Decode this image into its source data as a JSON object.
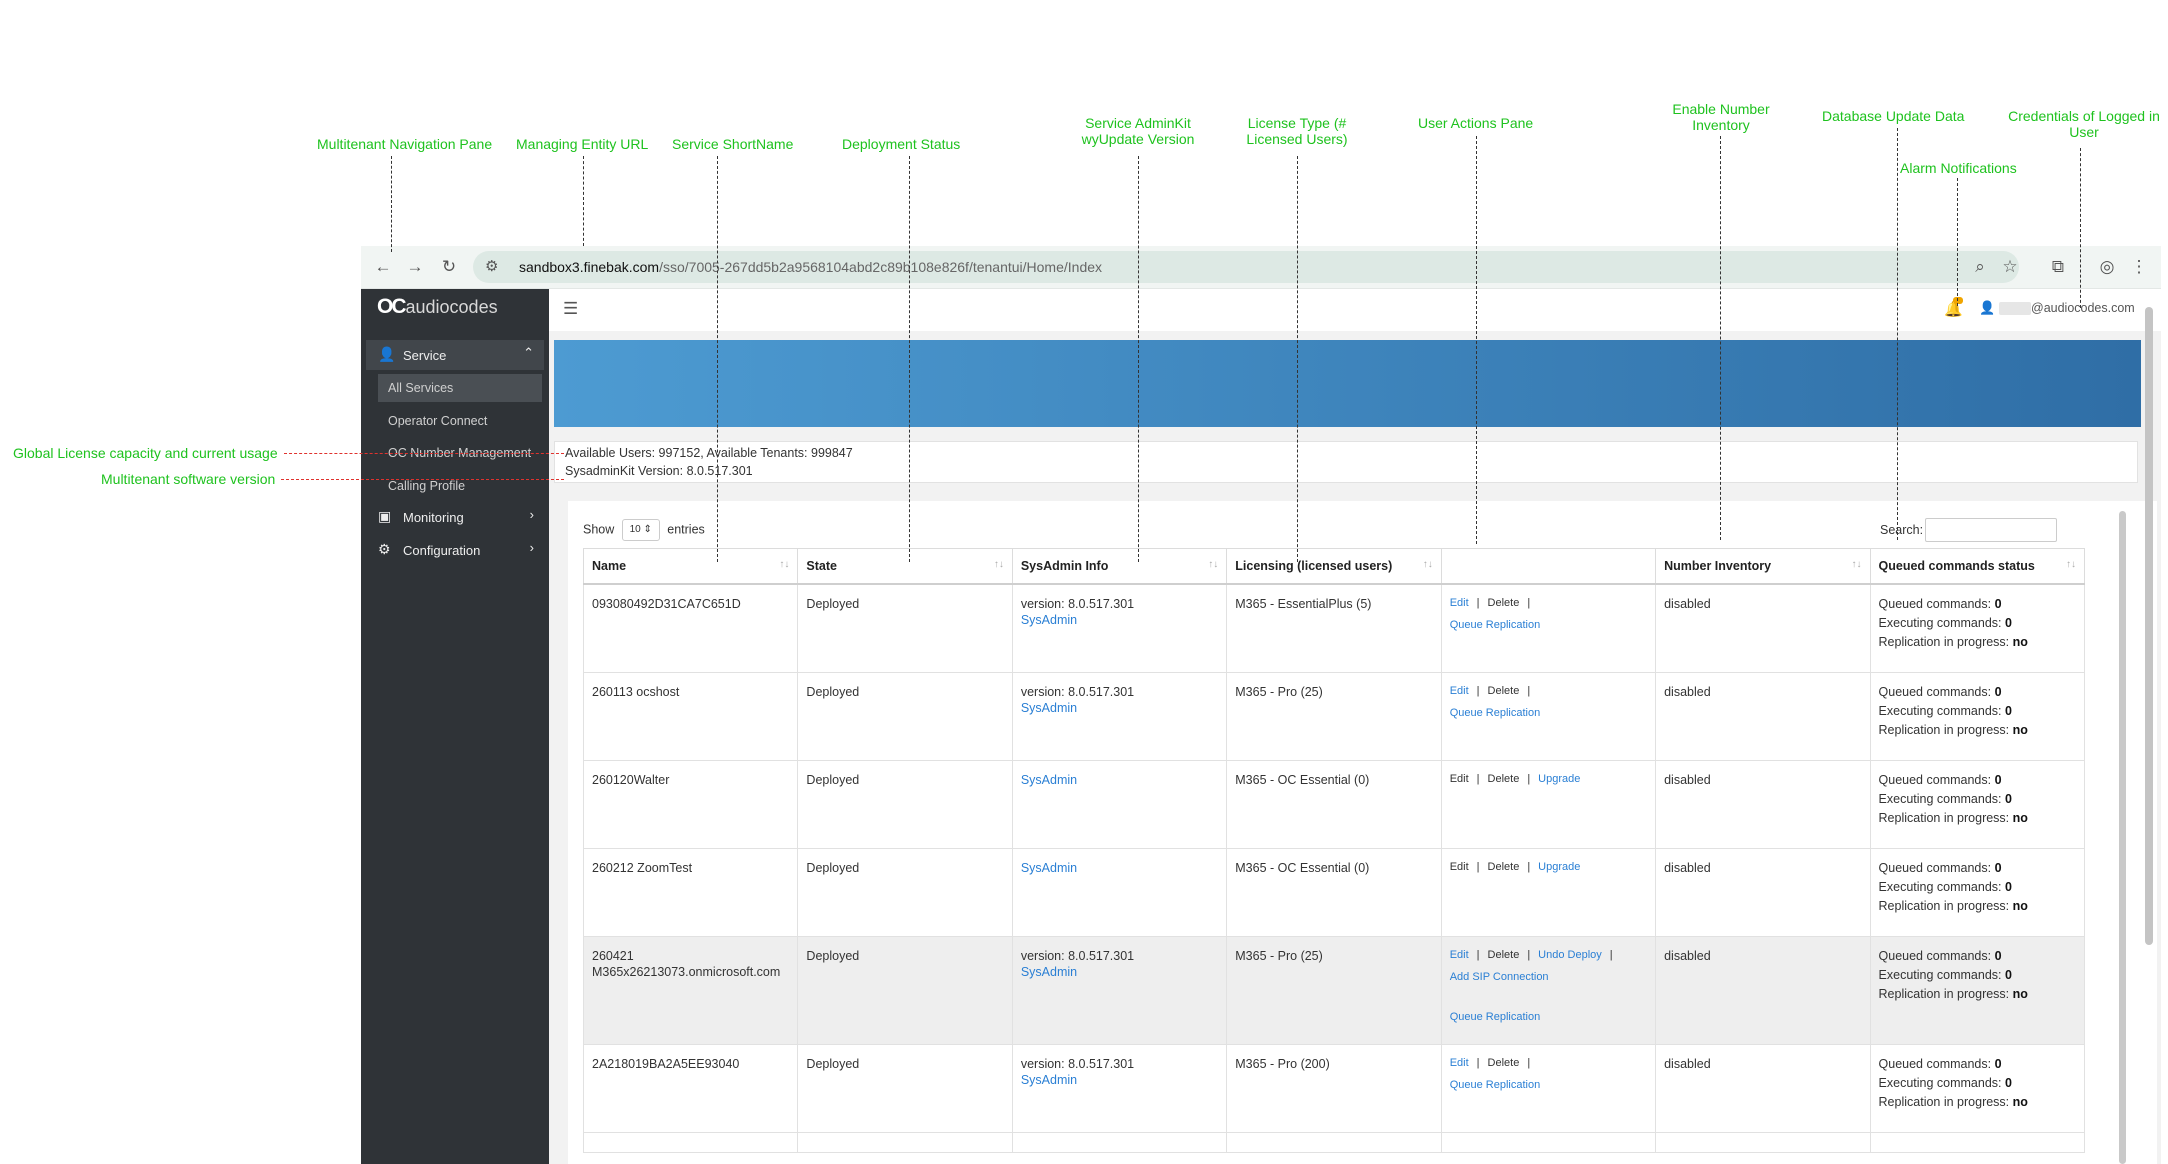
{
  "callouts": {
    "nav_pane": "Multitenant Navigation Pane",
    "entity_url": "Managing Entity URL",
    "shortname": "Service ShortName",
    "deploy_status": "Deployment Status",
    "adminkit_1": "Service AdminKit",
    "adminkit_2": "wyUpdate Version",
    "license_1": "License Type (#",
    "license_2": "Licensed Users)",
    "user_actions": "User Actions Pane",
    "number_inv_1": "Enable Number",
    "number_inv_2": "Inventory",
    "db_update": "Database Update Data",
    "credentials_1": "Credentials of Logged in",
    "credentials_2": "User",
    "alarm": "Alarm Notifications",
    "global_license": "Global License capacity and current usage",
    "sw_version": "Multitenant software version"
  },
  "browser": {
    "url_host": "sandbox3.finebak.com",
    "url_path": "/sso/7005-267dd5b2a9568104abd2c89b108e826f/tenantui/Home/Index",
    "icons": [
      "arrow-left-icon",
      "arrow-right-icon",
      "reload-icon",
      "site-info-icon",
      "zoom-icon",
      "star-icon",
      "extensions-icon",
      "profile-icon",
      "more-icon"
    ]
  },
  "sidebar": {
    "logo_mark": "OC",
    "logo_text": "audiocodes",
    "sections": [
      {
        "label": "Service",
        "icon": "user-icon"
      },
      {
        "label": "Monitoring",
        "icon": "monitor-icon"
      },
      {
        "label": "Configuration",
        "icon": "gear-icon"
      }
    ],
    "items": [
      "All Services",
      "Operator Connect",
      "OC Number Management",
      "Calling Profile"
    ]
  },
  "header": {
    "user_email": "@audiocodes.com"
  },
  "info": {
    "license_line": "Available Users: 997152, Available Tenants: 999847",
    "version_line": "SysadminKit Version: 8.0.517.301"
  },
  "table_controls": {
    "show_label": "Show",
    "page_size": "10 ⇕",
    "entries_label": "entries",
    "search_label": "Search:"
  },
  "table": {
    "columns": [
      "Name",
      "State",
      "SysAdmin Info",
      "Licensing (licensed users)",
      "",
      "Number Inventory",
      "Queued commands status"
    ],
    "sort_glyph": "↑↓",
    "labels": {
      "edit": "Edit",
      "delete": "Delete",
      "upgrade": "Upgrade",
      "undo_deploy": "Undo Deploy",
      "queue_replication": "Queue Replication",
      "add_sip": "Add SIP Connection",
      "sysadmin": "SysAdmin",
      "version_prefix": "version: ",
      "queued": "Queued commands: ",
      "executing": "Executing commands: ",
      "replication": "Replication in progress: "
    },
    "rows": [
      {
        "name": "093080492D31CA7C651D",
        "name2": "",
        "state": "Deployed",
        "version": "8.0.517.301",
        "license": "M365 - EssentialPlus (5)",
        "number_inventory": "disabled",
        "queued": "0",
        "executing": "0",
        "replication": "no"
      },
      {
        "name": "260113 ocshost",
        "name2": "",
        "state": "Deployed",
        "version": "8.0.517.301",
        "license": "M365 - Pro (25)",
        "number_inventory": "disabled",
        "queued": "0",
        "executing": "0",
        "replication": "no"
      },
      {
        "name": "260120Walter",
        "name2": "",
        "state": "Deployed",
        "version": "",
        "license": "M365 - OC Essential (0)",
        "number_inventory": "disabled",
        "queued": "0",
        "executing": "0",
        "replication": "no"
      },
      {
        "name": "260212 ZoomTest",
        "name2": "",
        "state": "Deployed",
        "version": "",
        "license": "M365 - OC Essential (0)",
        "number_inventory": "disabled",
        "queued": "0",
        "executing": "0",
        "replication": "no"
      },
      {
        "name": "260421",
        "name2": "M365x26213073.onmicrosoft.com",
        "state": "Deployed",
        "version": "8.0.517.301",
        "license": "M365 - Pro (25)",
        "number_inventory": "disabled",
        "queued": "0",
        "executing": "0",
        "replication": "no"
      },
      {
        "name": "2A218019BA2A5EE93040",
        "name2": "",
        "state": "Deployed",
        "version": "8.0.517.301",
        "license": "M365 - Pro (200)",
        "number_inventory": "disabled",
        "queued": "0",
        "executing": "0",
        "replication": "no"
      }
    ]
  },
  "colors": {
    "callout": "#1ec21e",
    "banner_start": "#4d9bd2",
    "banner_end": "#2f6ea6",
    "sidebar": "#2f3337",
    "link": "#2a7fd4"
  }
}
